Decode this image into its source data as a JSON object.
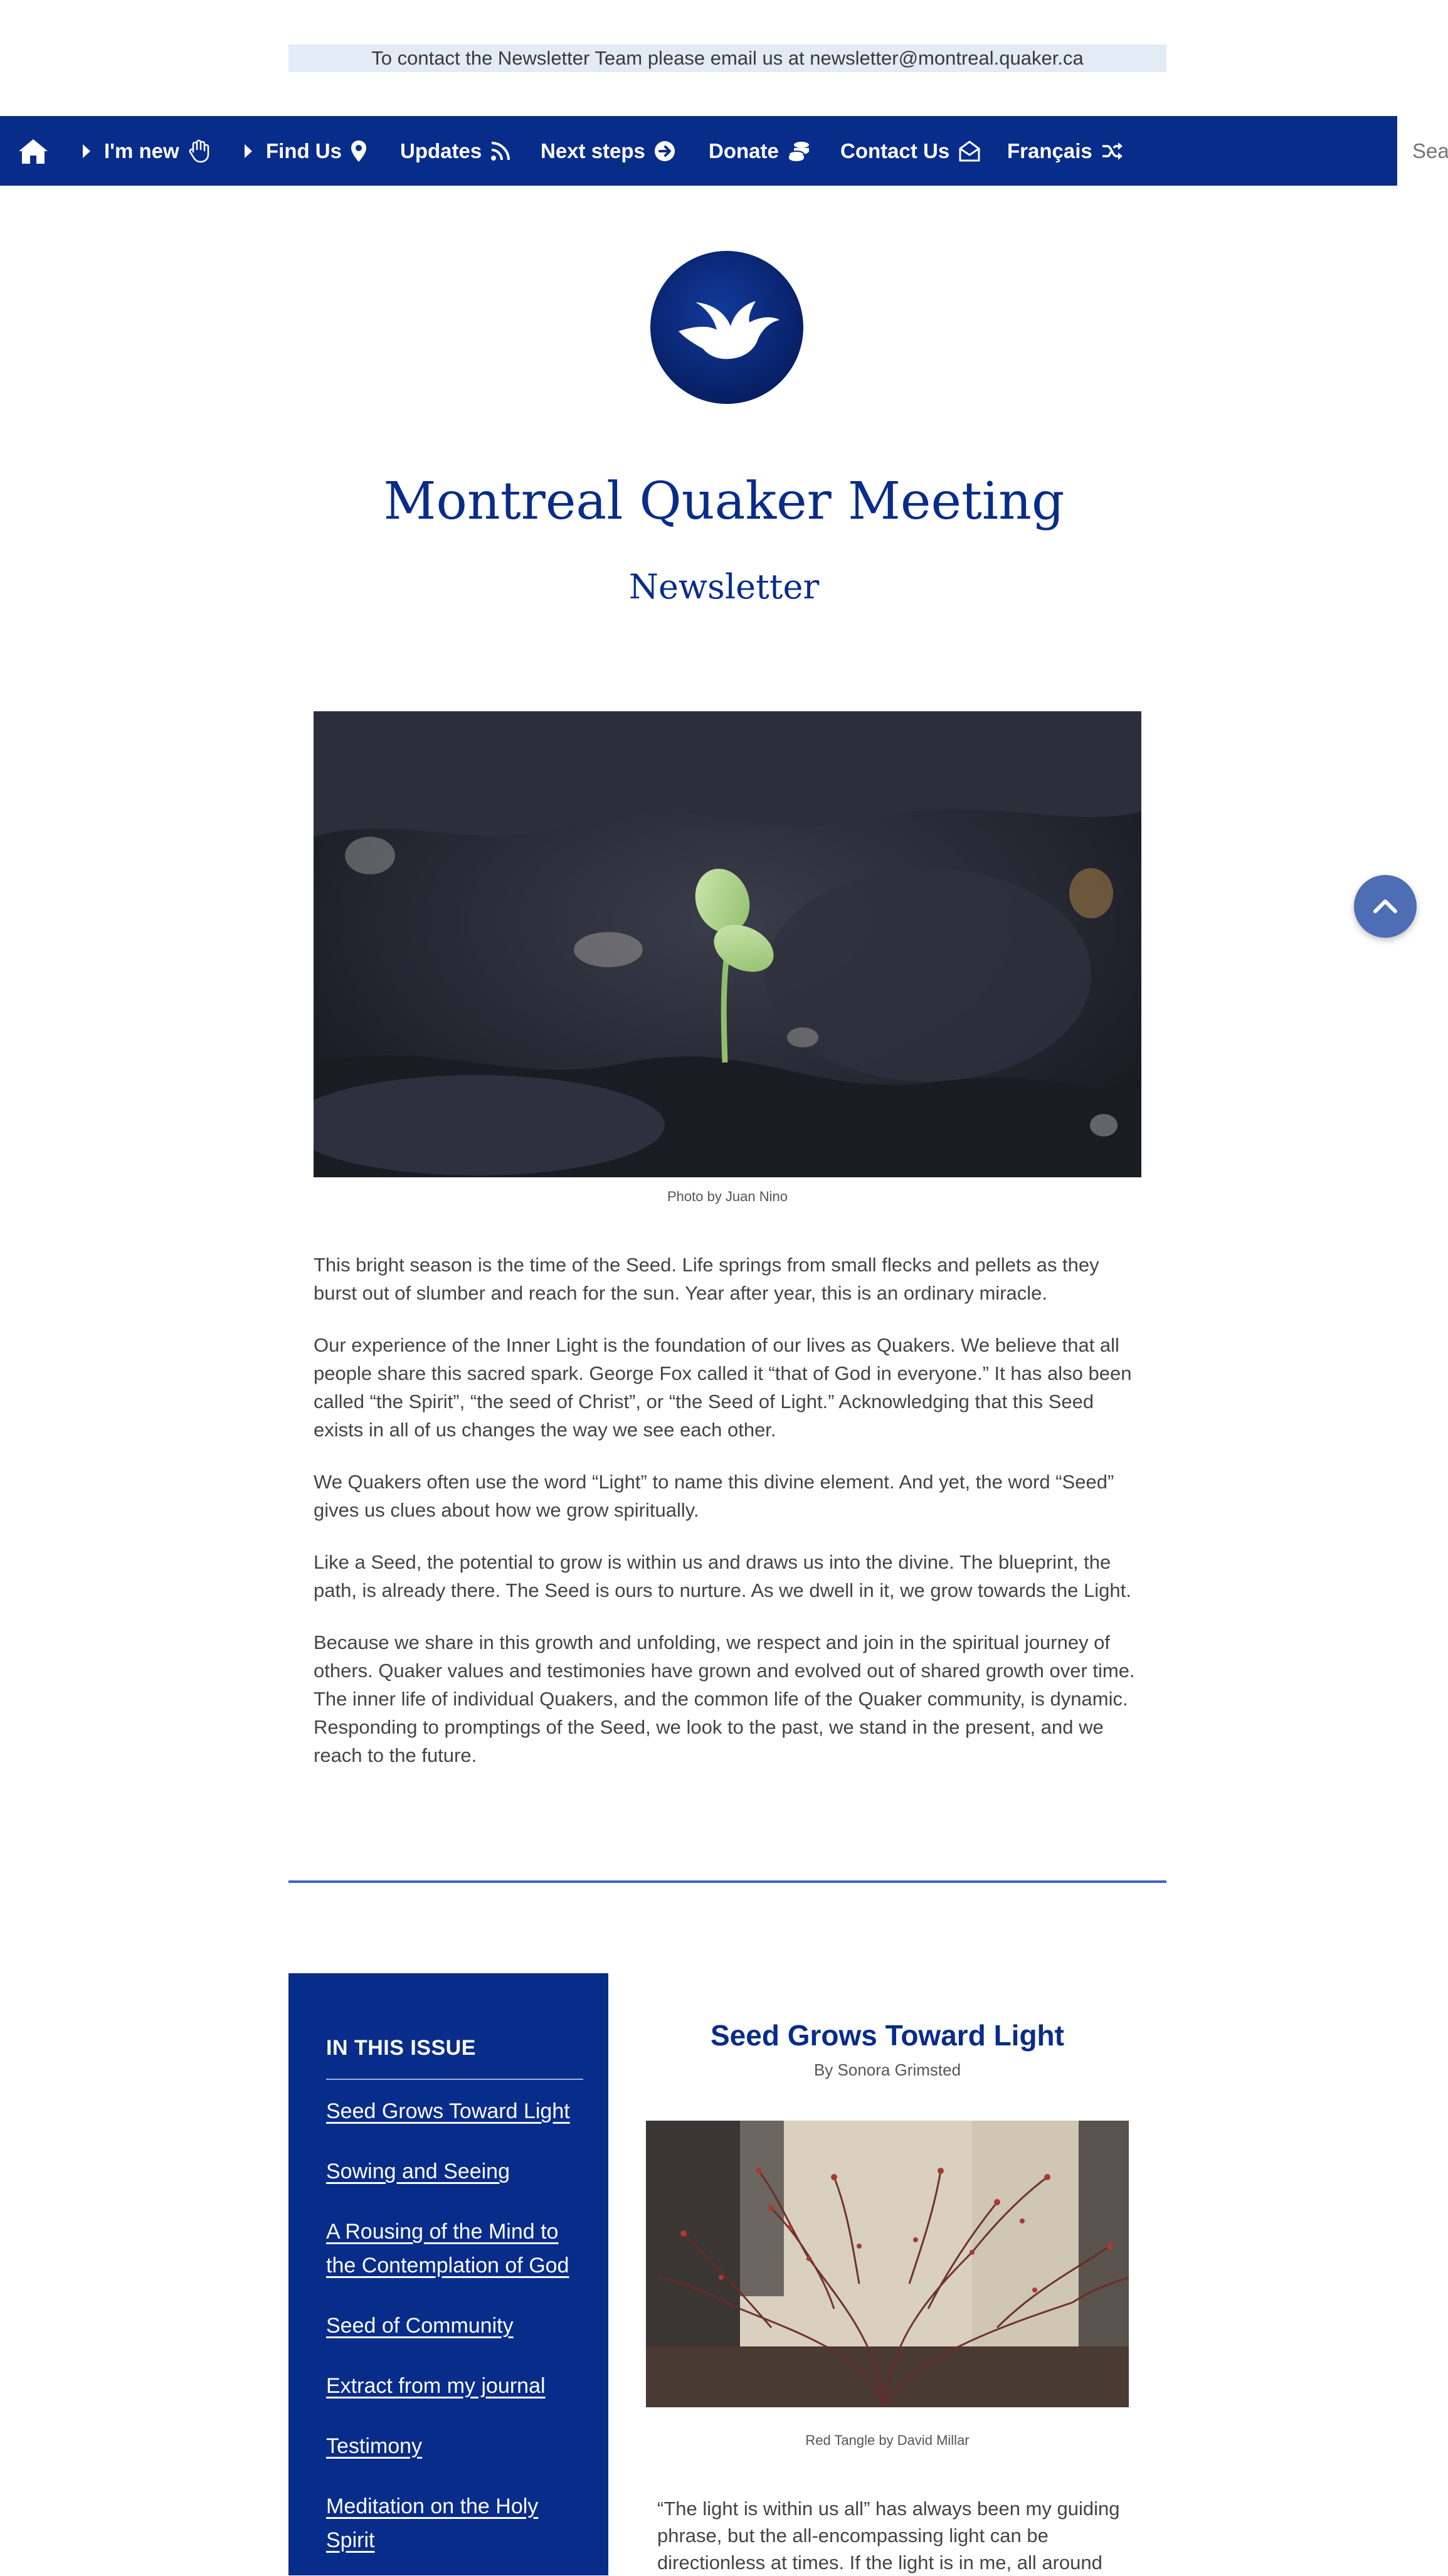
{
  "contact_bar": {
    "text": "To contact the Newsletter Team please email us at newsletter@montreal.quaker.ca"
  },
  "nav": {
    "home_icon": "home-icon",
    "items": [
      {
        "label": "I'm new",
        "icon": "hand-icon",
        "has_caret": true
      },
      {
        "label": "Find Us",
        "icon": "map-pin-icon",
        "has_caret": true
      },
      {
        "label": "Updates",
        "icon": "rss-icon",
        "has_caret": false
      },
      {
        "label": "Next steps",
        "icon": "arrow-circle-right-icon",
        "has_caret": false
      },
      {
        "label": "Donate",
        "icon": "coins-icon",
        "has_caret": false
      },
      {
        "label": "Contact Us",
        "icon": "envelope-open-icon",
        "has_caret": false
      },
      {
        "label": "Français",
        "icon": "shuffle-icon",
        "has_caret": false
      }
    ],
    "search_placeholder": "Search"
  },
  "header": {
    "title": "Montreal Quaker Meeting",
    "subtitle": "Newsletter",
    "logo_icon": "dove-icon"
  },
  "hero": {
    "caption": "Photo by Juan Nino"
  },
  "intro_paragraphs": [
    "This bright season is the time of the Seed.  Life springs from small flecks and pellets as they burst out of slumber and reach for the sun.  Year after year, this is an ordinary miracle.",
    "Our experience of the Inner Light is the foundation of our lives as Quakers. We believe that all people share this sacred spark. George Fox called it “that of God in everyone.” It has also been called “the Spirit”, “the seed of Christ”, or “the Seed of Light.” Acknowledging that this Seed exists in all of us changes the way we see each other.",
    "We Quakers often use the word “Light” to name this divine element.  And yet, the word “Seed” gives us clues about how we grow spiritually.",
    "Like a Seed, the potential to grow is within us and draws us into the divine. The blueprint, the path, is already there.  The Seed is ours to nurture. As we dwell in it, we grow towards the Light.",
    "Because we share in this growth and unfolding, we respect and join in the spiritual journey of others. Quaker values and testimonies have grown and evolved out of shared growth over time. The inner life of individual Quakers, and the common life of the Quaker community, is dynamic. Responding to promptings of the Seed, we look to the past, we stand in the present, and we reach to the future."
  ],
  "sidebar": {
    "heading": "IN THIS ISSUE",
    "links": [
      "Seed Grows Toward Light",
      "Sowing and Seeing",
      "A Rousing of the Mind to the Contemplation of God",
      "Seed of Community",
      "Extract from my journal",
      "Testimony",
      "Meditation on the Holy Spirit"
    ]
  },
  "article": {
    "title": "Seed Grows Toward Light",
    "byline": "By Sonora Grimsted",
    "image_caption": "Red Tangle by David Millar",
    "text": "“The light is within us all” has always been my guiding phrase, but the all-encompassing light can be directionless at times. If the light is in me, all around"
  },
  "scroll_top": {
    "icon": "chevron-up-icon"
  },
  "colors": {
    "brand": "#082c8a",
    "contact_bg": "#e3ebf5",
    "divider": "#3b64c2",
    "scroll_button": "#4d6db5"
  }
}
